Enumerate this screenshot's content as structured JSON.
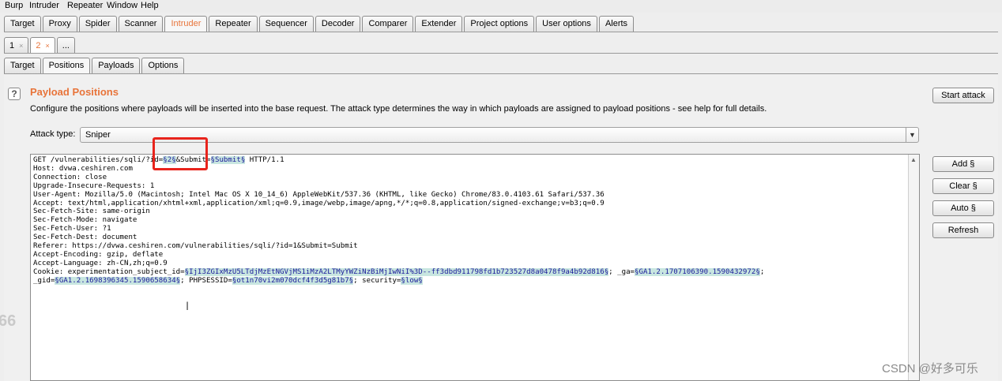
{
  "menu": [
    "Burp",
    "Intruder",
    "Repeater",
    "Window",
    "Help"
  ],
  "main_tabs": [
    "Target",
    "Proxy",
    "Spider",
    "Scanner",
    "Intruder",
    "Repeater",
    "Sequencer",
    "Decoder",
    "Comparer",
    "Extender",
    "Project options",
    "User options",
    "Alerts"
  ],
  "instance_tabs": [
    {
      "label": "1",
      "close": "×"
    },
    {
      "label": "2",
      "close": "×"
    },
    {
      "label": "..."
    }
  ],
  "sub_tabs": [
    "Target",
    "Positions",
    "Payloads",
    "Options"
  ],
  "help_icon": "?",
  "section_title": "Payload Positions",
  "description": "Configure the positions where payloads will be inserted into the base request. The attack type determines the way in which payloads are assigned to payload positions - see help for full details.",
  "attack_type_label": "Attack type:",
  "attack_type_value": "Sniper",
  "buttons": {
    "start_attack": "Start attack",
    "add": "Add §",
    "clear": "Clear §",
    "auto": "Auto §",
    "refresh": "Refresh"
  },
  "request": {
    "l01a": "GET /vulnerabilities/sqli/?id=",
    "l01b": "§2§",
    "l01c": "&Submit=",
    "l01d": "§Submit§",
    "l01e": " HTTP/1.1",
    "l02": "Host: dvwa.ceshiren.com",
    "l03": "Connection: close",
    "l04": "Upgrade-Insecure-Requests: 1",
    "l05": "User-Agent: Mozilla/5.0 (Macintosh; Intel Mac OS X 10_14_6) AppleWebKit/537.36 (KHTML, like Gecko) Chrome/83.0.4103.61 Safari/537.36",
    "l06": "Accept: text/html,application/xhtml+xml,application/xml;q=0.9,image/webp,image/apng,*/*;q=0.8,application/signed-exchange;v=b3;q=0.9",
    "l07": "Sec-Fetch-Site: same-origin",
    "l08": "Sec-Fetch-Mode: navigate",
    "l09": "Sec-Fetch-User: ?1",
    "l10": "Sec-Fetch-Dest: document",
    "l11": "Referer: https://dvwa.ceshiren.com/vulnerabilities/sqli/?id=1&Submit=Submit",
    "l12": "Accept-Encoding: gzip, deflate",
    "l13": "Accept-Language: zh-CN,zh;q=0.9",
    "l14a": "Cookie: experimentation_subject_id=",
    "l14b": "§IjI3ZGIxMzU5LTdjMzEtNGVjMS1iMzA2LTMyYWZiNzBiMjIwNiI%3D--ff3dbd911798fd1b723527d8a0478f9a4b92d816§",
    "l14c": "; _ga=",
    "l14d": "§GA1.2.1707106390.1590432972§",
    "l14e": ";",
    "l15a": "_gid=",
    "l15b": "§GA1.2.1698396345.1590658634§",
    "l15c": "; PHPSESSID=",
    "l15d": "§ot1n70vi2m070dcf4f3d5g81b7§",
    "l15e": "; security=",
    "l15f": "§low§"
  },
  "side_number": "66",
  "text_cursor": "I",
  "watermark": "CSDN @好多可乐",
  "colors": {
    "accent": "#e8743a",
    "highlight_box": "#e8241c",
    "payload_bg": "#c8e6e0"
  }
}
